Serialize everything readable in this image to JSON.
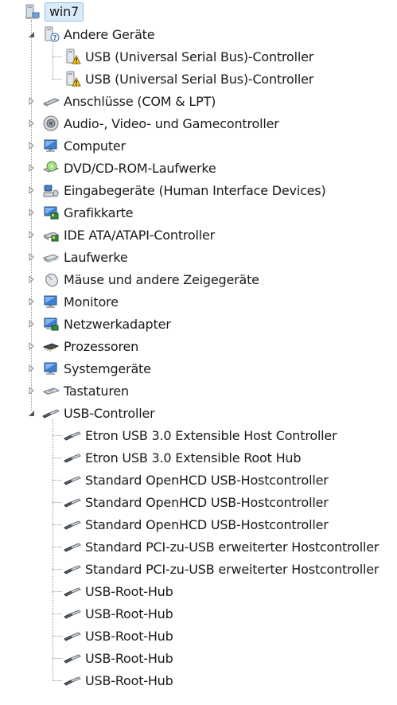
{
  "tree": {
    "root": {
      "label": "win7",
      "icon": "computer-icon"
    },
    "andere": {
      "label": "Andere Geräte",
      "icon": "unknown-device-icon",
      "children": [
        {
          "label": "USB (Universal Serial Bus)-Controller",
          "icon": "warning-device-icon"
        },
        {
          "label": "USB (Universal Serial Bus)-Controller",
          "icon": "warning-device-icon"
        }
      ]
    },
    "categories": [
      {
        "label": "Anschlüsse (COM & LPT)",
        "icon": "port-icon"
      },
      {
        "label": "Audio-, Video- und Gamecontroller",
        "icon": "speaker-icon"
      },
      {
        "label": "Computer",
        "icon": "monitor-icon"
      },
      {
        "label": "DVD/CD-ROM-Laufwerke",
        "icon": "disc-drive-icon"
      },
      {
        "label": "Eingabegeräte (Human Interface Devices)",
        "icon": "input-device-icon"
      },
      {
        "label": "Grafikkarte",
        "icon": "display-adapter-icon"
      },
      {
        "label": "IDE ATA/ATAPI-Controller",
        "icon": "ide-controller-icon"
      },
      {
        "label": "Laufwerke",
        "icon": "disk-drive-icon"
      },
      {
        "label": "Mäuse und andere Zeigegeräte",
        "icon": "mouse-icon"
      },
      {
        "label": "Monitore",
        "icon": "monitor-icon"
      },
      {
        "label": "Netzwerkadapter",
        "icon": "network-adapter-icon"
      },
      {
        "label": "Prozessoren",
        "icon": "processor-icon"
      },
      {
        "label": "Systemgeräte",
        "icon": "system-device-icon"
      },
      {
        "label": "Tastaturen",
        "icon": "keyboard-icon"
      }
    ],
    "usb": {
      "label": "USB-Controller",
      "icon": "usb-icon",
      "children": [
        {
          "label": "Etron USB 3.0 Extensible Host Controller",
          "icon": "usb-icon"
        },
        {
          "label": "Etron USB 3.0 Extensible Root Hub",
          "icon": "usb-icon"
        },
        {
          "label": "Standard OpenHCD USB-Hostcontroller",
          "icon": "usb-icon"
        },
        {
          "label": "Standard OpenHCD USB-Hostcontroller",
          "icon": "usb-icon"
        },
        {
          "label": "Standard OpenHCD USB-Hostcontroller",
          "icon": "usb-icon"
        },
        {
          "label": "Standard PCI-zu-USB erweiterter Hostcontroller",
          "icon": "usb-icon"
        },
        {
          "label": "Standard PCI-zu-USB erweiterter Hostcontroller",
          "icon": "usb-icon"
        },
        {
          "label": "USB-Root-Hub",
          "icon": "usb-icon"
        },
        {
          "label": "USB-Root-Hub",
          "icon": "usb-icon"
        },
        {
          "label": "USB-Root-Hub",
          "icon": "usb-icon"
        },
        {
          "label": "USB-Root-Hub",
          "icon": "usb-icon"
        },
        {
          "label": "USB-Root-Hub",
          "icon": "usb-icon"
        }
      ]
    }
  }
}
